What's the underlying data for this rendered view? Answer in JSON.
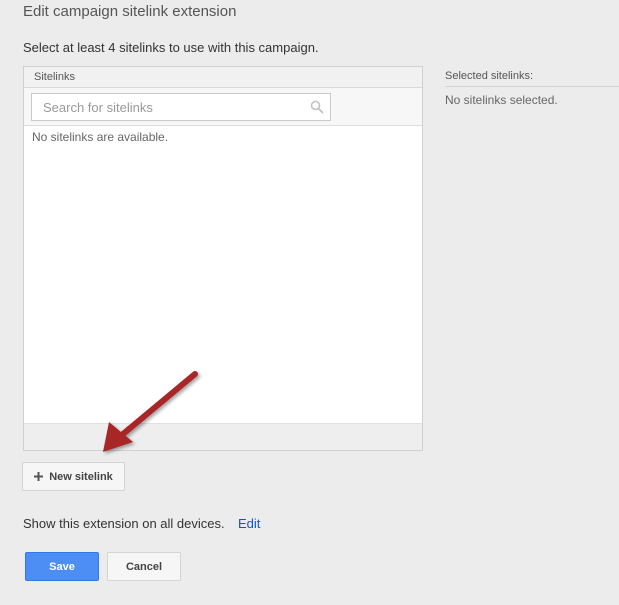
{
  "page": {
    "title": "Edit campaign sitelink extension",
    "instructions": "Select at least 4 sitelinks to use with this campaign."
  },
  "sitelinks_panel": {
    "header": "Sitelinks",
    "search_placeholder": "Search for sitelinks",
    "search_value": "",
    "empty_message": "No sitelinks are available."
  },
  "selected_panel": {
    "header": "Selected sitelinks:",
    "empty_message": "No sitelinks selected."
  },
  "actions": {
    "new_sitelink_label": "New sitelink",
    "devices_text": "Show this extension on all devices.",
    "edit_label": "Edit",
    "save_label": "Save",
    "cancel_label": "Cancel"
  },
  "icons": {
    "search": "search-icon",
    "plus": "plus-icon",
    "annotation_arrow": "arrow-icon"
  },
  "colors": {
    "primary_button": "#4d8ef5",
    "link": "#1155cc",
    "annotation_arrow": "#a82525",
    "background": "#ececec"
  }
}
